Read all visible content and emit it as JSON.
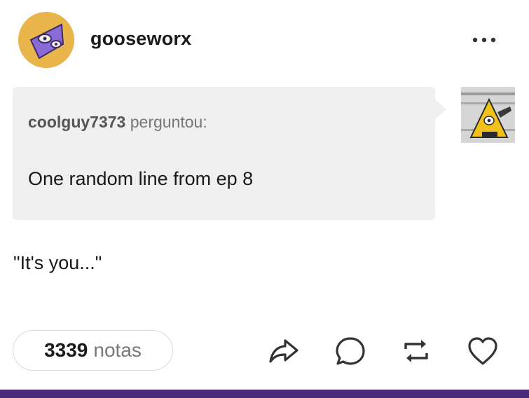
{
  "post": {
    "username": "gooseworx",
    "ask": {
      "asker": "coolguy7373",
      "verb": "perguntou:",
      "question": "One random line from ep 8"
    },
    "answer": "\"It's you...\"",
    "notes": {
      "count": "3339",
      "label": "notas"
    }
  },
  "icons": {
    "more": "more-dots-icon",
    "share": "share-icon",
    "reply": "reply-icon",
    "reblog": "reblog-icon",
    "like": "heart-icon"
  },
  "colors": {
    "accent_bar": "#4a2a78",
    "bubble": "#efefef",
    "text": "#1a1a1a",
    "muted": "#777777"
  }
}
